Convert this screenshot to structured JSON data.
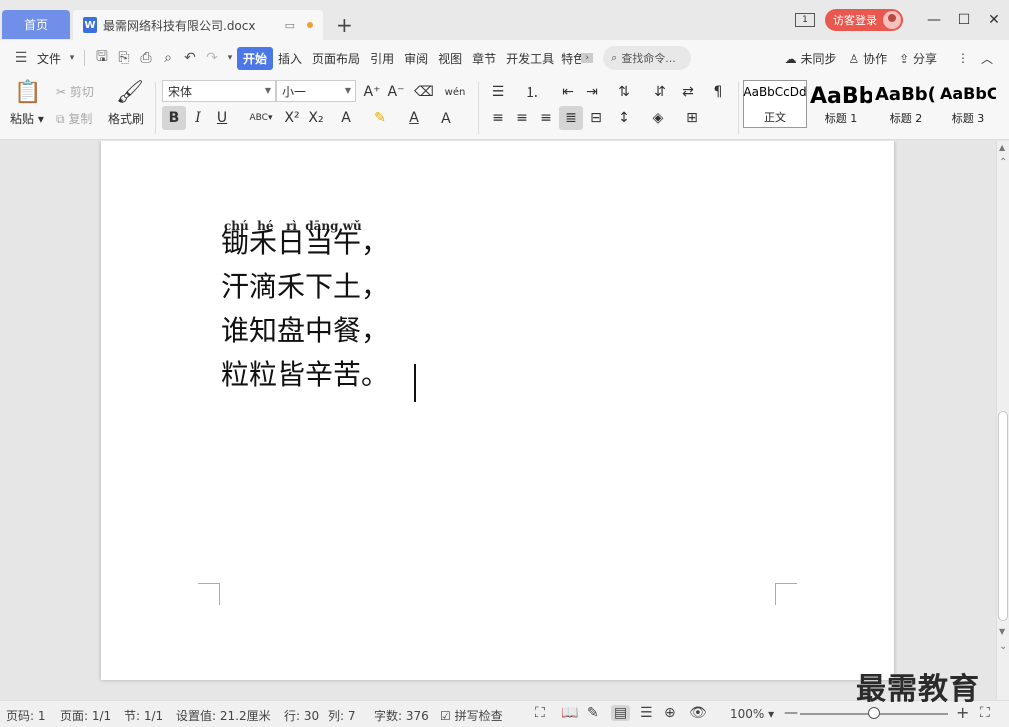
{
  "titlebar": {
    "home_tab": "首页",
    "doc_tab_icon": "W",
    "doc_tab": "最需网络科技有限公司.docx",
    "page_indicator": "1",
    "login": "访客登录",
    "icons": [
      "monitor-icon",
      "plus-icon",
      "minimize-icon",
      "maximize-icon",
      "close-icon"
    ]
  },
  "menu": {
    "file": "文件",
    "items": [
      "开始",
      "插入",
      "页面布局",
      "引用",
      "审阅",
      "视图",
      "章节",
      "开发工具",
      "特色"
    ],
    "active": "开始",
    "search": "查找命令...",
    "unsync": "未同步",
    "collab": "协作",
    "share": "分享"
  },
  "ribbon": {
    "paste": "粘贴",
    "cut": "剪切",
    "copy": "复制",
    "format_painter": "格式刷",
    "font_name": "宋体",
    "font_size": "小一",
    "pinyin_icon": "wén",
    "bold": "B",
    "italic": "I",
    "underline": "U",
    "styles": [
      {
        "preview": "AaBbCcDd",
        "label": "正文"
      },
      {
        "preview": "AaBb",
        "label": "标题 1"
      },
      {
        "preview": "AaBb(",
        "label": "标题 2"
      },
      {
        "preview": "AaBbC",
        "label": "标题 3"
      }
    ]
  },
  "document": {
    "pinyin": "chú  hé   rì  dāng wǔ",
    "lines": [
      "锄禾日当午，",
      "汗滴禾下土，",
      "谁知盘中餐，",
      "粒粒皆辛苦。"
    ]
  },
  "status": {
    "page_code": "页码: 1",
    "page": "页面: 1/1",
    "section": "节: 1/1",
    "setting": "设置值: 21.2厘米",
    "row": "行: 30",
    "col": "列: 7",
    "words": "字数: 376",
    "spell": "拼写检查",
    "zoom": "100%",
    "zoom_fraction": 0.5
  },
  "watermark": "最需教育",
  "colors": {
    "accent": "#4b78e6",
    "home_tab": "#6f8fe8",
    "login": "#e9584f"
  }
}
